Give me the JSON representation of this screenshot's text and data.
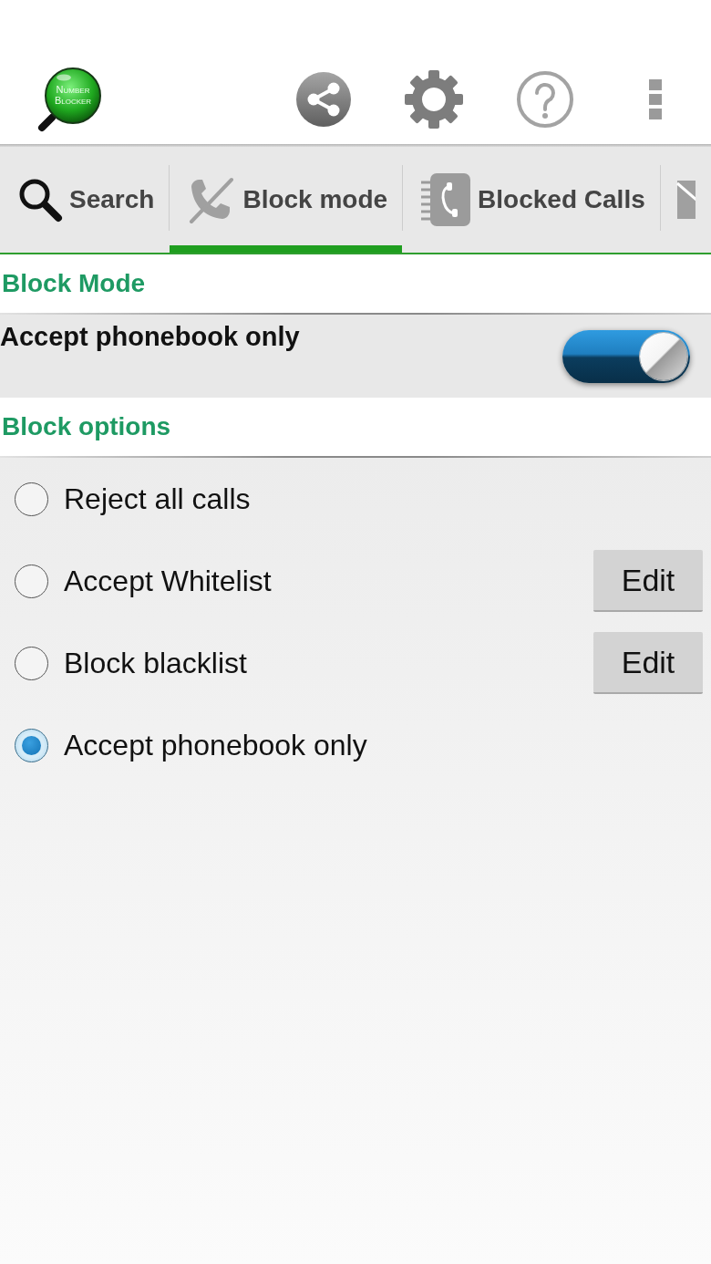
{
  "app_bar": {
    "logo": [
      "NUMBER",
      "BLOCKER"
    ]
  },
  "tabs": [
    {
      "label": "Search",
      "selected": false
    },
    {
      "label": "Block mode",
      "selected": true
    },
    {
      "label": "Blocked Calls",
      "selected": false
    },
    {
      "selected": false
    }
  ],
  "sections": [
    {
      "title": "Block Mode",
      "rows": [
        {
          "kind": "switch",
          "label": "Accept phonebook only",
          "on": true
        }
      ]
    },
    {
      "title": "Block options",
      "rows": [
        {
          "kind": "radio",
          "label": "Reject all calls",
          "selected": false
        },
        {
          "kind": "radio",
          "label": "Accept Whitelist",
          "selected": false,
          "button": "Edit"
        },
        {
          "kind": "radio",
          "label": "Block blacklist",
          "selected": false,
          "button": "Edit"
        },
        {
          "kind": "radio",
          "label": "Accept phonebook only",
          "selected": true
        }
      ]
    }
  ]
}
